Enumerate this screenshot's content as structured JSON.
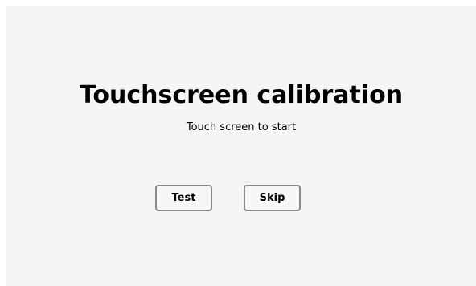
{
  "calibration": {
    "title": "Touchscreen calibration",
    "instruction": "Touch screen to start"
  },
  "buttons": {
    "test_label": "Test",
    "skip_label": "Skip"
  },
  "colors": {
    "background": "#f5f5f5",
    "button_border": "#8a8a8a",
    "text": "#000000"
  }
}
